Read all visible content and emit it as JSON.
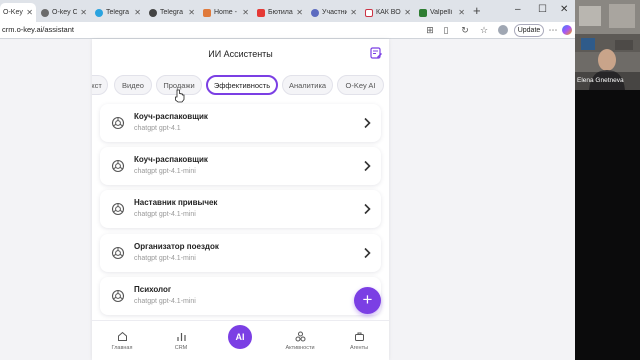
{
  "browser": {
    "tabs": [
      {
        "title": "O-Key",
        "favicon_color": "#3b6fd8",
        "active": true
      },
      {
        "title": "O-key C",
        "favicon_color": "#6b6b6b",
        "active": false
      },
      {
        "title": "Telegra",
        "favicon_color": "#2aa3df",
        "active": false
      },
      {
        "title": "Telegra",
        "favicon_color": "#2aa3df",
        "active": false
      },
      {
        "title": "Home -",
        "favicon_color": "#e07a3b",
        "active": false
      },
      {
        "title": "Бютилай",
        "favicon_color": "#e53935",
        "active": false
      },
      {
        "title": "Участни",
        "favicon_color": "#5c6bc0",
        "active": false
      },
      {
        "title": "КАК ВОС",
        "favicon_color": "#cc3344",
        "active": false
      },
      {
        "title": "Valpelli",
        "favicon_color": "#2e7d32",
        "active": false
      }
    ],
    "url": "crm.o-key.ai/assistant",
    "update_label": "Update",
    "icons": [
      "reading-mode-icon",
      "split-screen-icon",
      "favorites-icon",
      "refresh-icon",
      "extensions-icon",
      "profile-icon",
      "menu-icon",
      "copilot-icon"
    ]
  },
  "app": {
    "title": "ИИ Ассистенты",
    "categories": [
      "кст",
      "Видео",
      "Продажи",
      "Эффективность",
      "Аналитика",
      "O-Key AI"
    ],
    "active_category": "Эффективность",
    "assistants": [
      {
        "name": "Коуч-распаковщик",
        "model": "chatgpt gpt-4.1"
      },
      {
        "name": "Коуч-распаковщик",
        "model": "chatgpt gpt-4.1-mini"
      },
      {
        "name": "Наставник привычек",
        "model": "chatgpt gpt-4.1-mini"
      },
      {
        "name": "Организатор поездок",
        "model": "chatgpt gpt-4.1-mini"
      },
      {
        "name": "Психолог",
        "model": "chatgpt gpt-4.1-mini"
      }
    ],
    "fab_label": "+",
    "nav": {
      "home": "Главная",
      "crm": "CRM",
      "ai": "AI",
      "activity": "Активности",
      "agents": "Агенты"
    },
    "accent_color": "#7b3fe4"
  },
  "video": {
    "participant_name": "Elena Gnetneva"
  }
}
